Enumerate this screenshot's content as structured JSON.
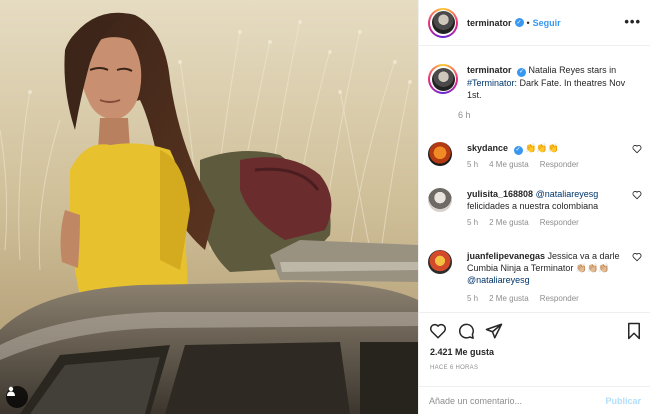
{
  "post": {
    "account": "terminator",
    "follow_label": "Seguir",
    "separator": "•",
    "more_label": "•••"
  },
  "caption": {
    "username": "terminator",
    "text_before": " Natalia Reyes stars in ",
    "hashtag": "#Terminator",
    "text_after": ": Dark Fate. In theatres Nov 1st.",
    "time": "6 h"
  },
  "comments": [
    {
      "username": "skydance",
      "text": "👏👏👏",
      "time": "5 h",
      "likes": "4 Me gusta",
      "reply": "Responder"
    },
    {
      "username": "yulisita_168808",
      "mention": "@nataliareyesg",
      "text": " felicidades a nuestra colombiana",
      "time": "5 h",
      "likes": "2 Me gusta",
      "reply": "Responder"
    },
    {
      "username": "juanfelipevanegas",
      "text": " Jessica va a darle Cumbia Ninja a Terminator 👏🏼👏🏼👏🏼 ",
      "mention": "@nataliareyesg",
      "time": "5 h",
      "likes": "2 Me gusta",
      "reply": "Responder"
    }
  ],
  "engagement": {
    "likes": "2.421 Me gusta",
    "posted": "HACE 6 HORAS"
  },
  "composer": {
    "placeholder": "Añade un comentario...",
    "publish_label": "Publicar"
  },
  "icons": [
    "heart-icon",
    "comment-icon",
    "share-icon",
    "bookmark-icon",
    "user-icon",
    "verified-icon",
    "more-icon"
  ],
  "colors": {
    "link": "#3897f0",
    "hashtag": "#003569",
    "muted": "#8e8e8e",
    "publish_disabled": "#b2dffc"
  }
}
